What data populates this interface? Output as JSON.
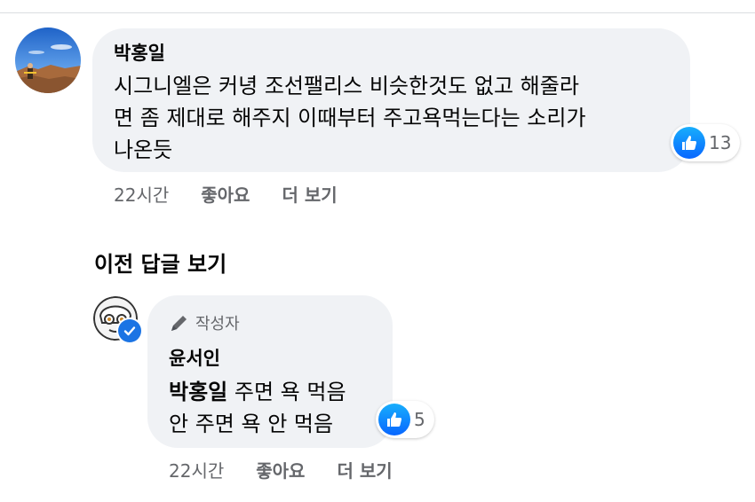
{
  "comment": {
    "author": "박홍일",
    "text_lines": [
      "시그니엘은 커녕 조선팰리스 비슷한것도 없고 해줄라",
      "면 좀 제대로 해주지 이때부터 주고욕먹는다는 소리가",
      "나온듯"
    ],
    "reaction_count": "13",
    "time": "22시간",
    "like_label": "좋아요",
    "more_label": "더 보기"
  },
  "previous_replies_label": "이전 답글 보기",
  "reply": {
    "badge_label": "작성자",
    "author": "윤서인",
    "mention": "박홍일",
    "line1_rest": " 주면 욕 먹음",
    "line2": "안 주면 욕 안 먹음",
    "reaction_count": "5",
    "time": "22시간",
    "like_label": "좋아요",
    "more_label": "더 보기"
  },
  "colors": {
    "bubble": "#f0f2f5",
    "secondary_text": "#65676b",
    "like_blue": "#0866ff",
    "verified_blue": "#1b74e4"
  },
  "icons": [
    "thumbs-up-icon",
    "pen-icon",
    "check-icon"
  ]
}
